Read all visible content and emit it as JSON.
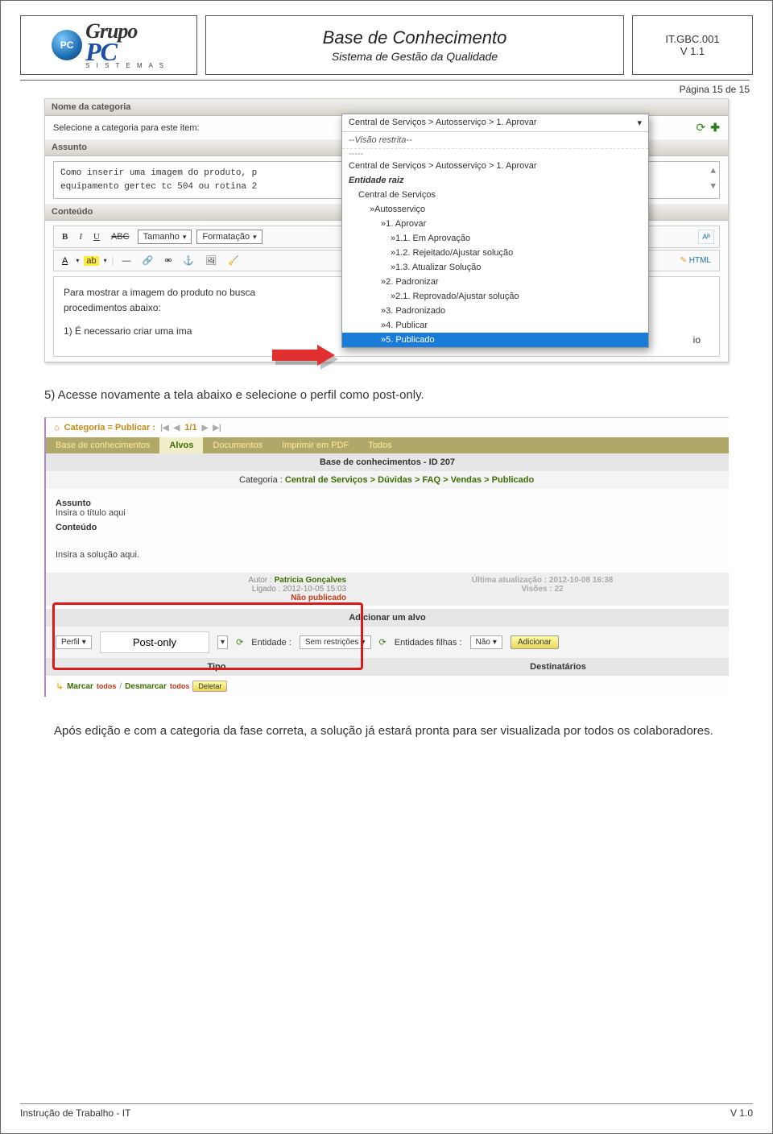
{
  "header": {
    "brand_top": "Grupo",
    "brand_main": "PC",
    "brand_sub": "S I S T E M A S",
    "title": "Base de Conhecimento",
    "subtitle": "Sistema de Gestão da Qualidade",
    "code": "IT.GBC.001",
    "version": "V 1.1"
  },
  "page_label": "Página 15 de 15",
  "screenshot1": {
    "sec_nome": "Nome da categoria",
    "label_selecione": "Selecione a categoria para este item:",
    "sel_value": "Central de Serviços > Autosserviço > 1. Aprovar",
    "sec_assunto": "Assunto",
    "assunto_l1": "Como inserir uma imagem do produto,  p",
    "assunto_l2": "equipamento gertec tc 504 ou rotina 2",
    "sec_conteudo": "Conteúdo",
    "tb_size": "Tamanho",
    "tb_format": "Formatação",
    "tb_html": "HTML",
    "body_p1": "Para mostrar a imagem do produto no busca",
    "body_p2": "procedimentos abaixo:",
    "body_p3": "1) É necessario criar uma ima",
    "body_trail": "io",
    "dd": {
      "top": "Central de Serviços > Autosserviço > 1. Aprovar",
      "visao": "--Visão restrita--",
      "dashes": "-----",
      "rep": "Central de Serviços > Autosserviço > 1. Aprovar",
      "ent": "Entidade raiz",
      "central": "Central de Serviços",
      "auto": "»Autosserviço",
      "n1": "»1. Aprovar",
      "n11": "»1.1. Em Aprovação",
      "n12": "»1.2. Rejeitado/Ajustar solução",
      "n13": "»1.3. Atualizar Solução",
      "n2": "»2. Padronizar",
      "n21": "»2.1. Reprovado/Ajustar solução",
      "n3": "»3. Padronizado",
      "n4": "»4. Publicar",
      "n5": "»5. Publicado"
    }
  },
  "step5": "5)   Acesse novamente a tela abaixo e selecione o perfil como post-only.",
  "screenshot2": {
    "crumb": "Categoria = Publicar :",
    "pager": "1/1",
    "tabs": [
      "Base de conhecimentos",
      "Alvos",
      "Documentos",
      "Imprimir em PDF",
      "Todos"
    ],
    "kb_title": "Base de conhecimentos - ID 207",
    "cat_label": "Categoria :",
    "cat_path": "Central de Serviços > Dúvidas > FAQ > Vendas > Publicado",
    "lbl_assunto": "Assunto",
    "ph_assunto": "Insira o título aqui",
    "lbl_conteudo": "Conteúdo",
    "ph_conteudo": "Insira a solução aqui.",
    "author_lbl": "Autor :",
    "author_name": "Patricia Gonçalves",
    "ligado": "Ligado : 2012-10-05 15:03",
    "nopub": "Não publicado",
    "upd": "Última atualização : 2012-10-08 16:38",
    "views": "Visões : 22",
    "target_head": "Adicionar um alvo",
    "perfil": "Perfil",
    "post_only": "Post-only",
    "ent_lbl": "Entidade :",
    "ent_val": "Sem restrições",
    "filhas_lbl": "Entidades filhas :",
    "filhas_val": "Não",
    "btn_add": "Adicionar",
    "col_tipo": "Tipo",
    "col_dest": "Destinatários",
    "marcar": "Marcar",
    "desmarcar": "Desmarcar",
    "todos": "todos",
    "deletar": "Deletar"
  },
  "closing": "Após edição e com a categoria da fase correta, a solução já estará pronta para ser visualizada por todos os colaboradores.",
  "footer": {
    "left": "Instrução de Trabalho - IT",
    "right": "V 1.0"
  }
}
